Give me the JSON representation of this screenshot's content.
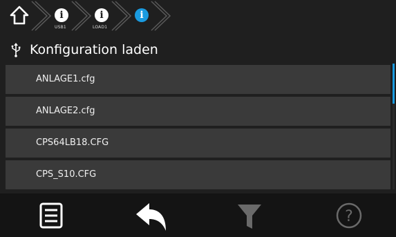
{
  "breadcrumb": {
    "home_icon": "home-icon",
    "items": [
      {
        "label": "USB1",
        "icon": "info-icon"
      },
      {
        "label": "LOAD1",
        "icon": "info-icon"
      },
      {
        "label": "",
        "icon": "info-icon",
        "active": true
      }
    ]
  },
  "header": {
    "icon": "usb-icon",
    "title": "Konfiguration laden"
  },
  "files": [
    {
      "name": "ANLAGE1.cfg"
    },
    {
      "name": "ANLAGE2.cfg"
    },
    {
      "name": "CPS64LB18.CFG"
    },
    {
      "name": "CPS_S10.CFG"
    }
  ],
  "toolbar": {
    "buttons": [
      {
        "icon": "menu-list-icon",
        "enabled": true
      },
      {
        "icon": "back-arrow-icon",
        "enabled": true
      },
      {
        "icon": "filter-icon",
        "enabled": false
      },
      {
        "icon": "help-icon",
        "enabled": false
      }
    ]
  },
  "colors": {
    "accent": "#1a9be0",
    "background": "#1f1f1f",
    "row": "#3a3a3a",
    "toolbar": "#141414",
    "disabled": "#6a6a6a"
  }
}
